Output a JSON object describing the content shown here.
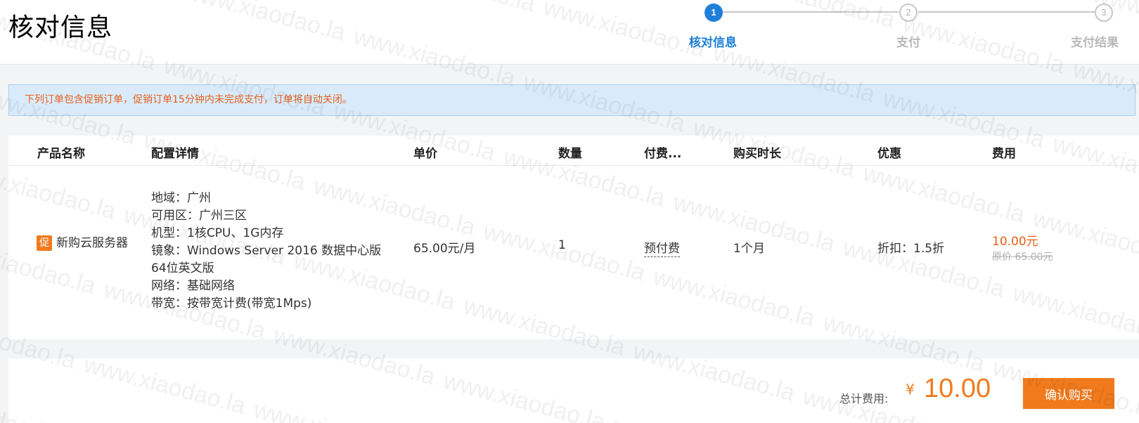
{
  "header": {
    "title": "核对信息",
    "steps": [
      {
        "number": "1",
        "label": "核对信息",
        "state": "active"
      },
      {
        "number": "2",
        "label": "支付",
        "state": "inactive"
      },
      {
        "number": "3",
        "label": "支付结果",
        "state": "inactive"
      }
    ]
  },
  "notice": {
    "text": "下列订单包含促销订单，促销订单15分钟内未完成支付，订单将自动关闭。"
  },
  "table": {
    "columns": [
      "产品名称",
      "配置详情",
      "单价",
      "数量",
      "付费...",
      "购买时长",
      "优惠",
      "费用"
    ],
    "row": {
      "promo_tag": "促",
      "product_name": "新购云服务器",
      "config": [
        "地域：广州",
        "可用区：广州三区",
        "机型：1核CPU、1G内存",
        "镜象：Windows Server 2016 数据中心版",
        "64位英文版",
        "网络：基础网络",
        "带宽：按带宽计费(带宽1Mps)"
      ],
      "unit_price": "65.00元/月",
      "quantity": "1",
      "pay_type": "预付费",
      "duration": "1个月",
      "discount": "折扣：1.5折",
      "fee": "10.00元",
      "original_price": "原价 65.00元"
    }
  },
  "footer": {
    "total_label": "总计费用:",
    "currency": "¥",
    "total_amount": "10.00",
    "confirm_label": "确认购买"
  },
  "colors": {
    "accent_blue": "#1e7fd9",
    "accent_orange": "#f17a1d",
    "notice_bg": "#d9ebfa",
    "notice_text": "#e8601c"
  },
  "watermark": "www.xiaodao.la"
}
